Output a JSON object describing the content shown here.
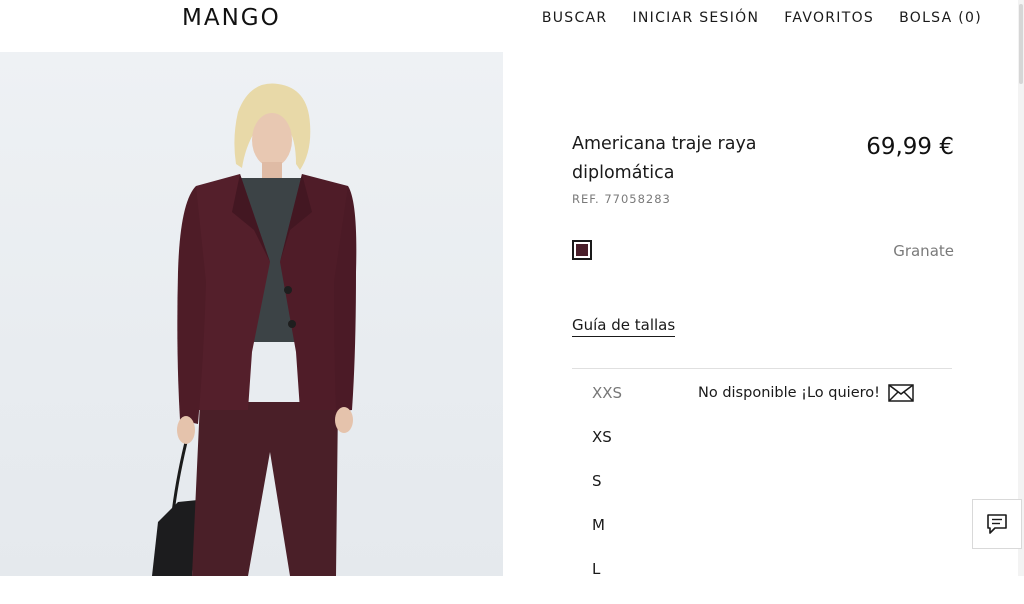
{
  "brand": {
    "logo": "MANGO"
  },
  "nav": {
    "search": "BUSCAR",
    "login": "INICIAR SESIÓN",
    "favorites": "FAVORITOS",
    "bag": "BOLSA (0)"
  },
  "product": {
    "title": "Americana traje raya diplomática",
    "price": "69,99 €",
    "ref": "REF. 77058283",
    "color": {
      "name": "Granate",
      "hex": "#4a1f2a"
    },
    "size_guide": "Guía de tallas",
    "sizes": [
      {
        "label": "XXS",
        "available": false,
        "notify": "No disponible ¡Lo quiero!"
      },
      {
        "label": "XS",
        "available": true
      },
      {
        "label": "S",
        "available": true
      },
      {
        "label": "M",
        "available": true
      },
      {
        "label": "L",
        "available": true
      }
    ]
  },
  "icons": {
    "notify": "envelope-icon",
    "chat": "chat-icon"
  },
  "colors": {
    "background": "#ffffff",
    "text": "#1a1a1a",
    "muted": "#7a7a7a",
    "image_bg": "#e8ecf0"
  }
}
